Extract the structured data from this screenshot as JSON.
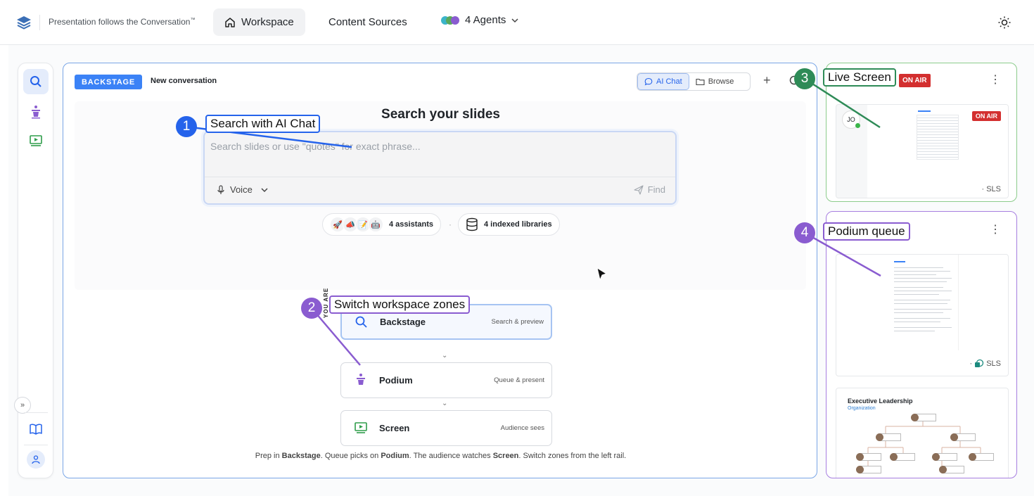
{
  "header": {
    "tagline": "Presentation follows the Conversation",
    "tagline_tm": "™",
    "nav": {
      "workspace": "Workspace",
      "content_sources": "Content Sources",
      "agents": "4 Agents"
    }
  },
  "colors": {
    "accent": "#3b82f6",
    "live": "#4caf50",
    "podium": "#8a5cd0",
    "onair": "#d32f2f"
  },
  "backstage": {
    "badge": "BACKSTAGE",
    "conversation": "New conversation",
    "tabs": {
      "chat": "AI Chat",
      "browse": "Browse"
    },
    "heading": "Search your slides",
    "search_placeholder": "Search slides or use \"quotes\" for exact phrase...",
    "voice": "Voice",
    "find": "Find",
    "assistants": "4 assistants",
    "libraries": "4 indexed libraries"
  },
  "zones": {
    "you_are_here": "YOU ARE",
    "items": [
      {
        "name": "Backstage",
        "desc": "Search & preview"
      },
      {
        "name": "Podium",
        "desc": "Queue & present"
      },
      {
        "name": "Screen",
        "desc": "Audience sees"
      }
    ],
    "footer": {
      "p1": "Prep in ",
      "b1": "Backstage",
      "p2": ". Queue picks on ",
      "b2": "Podium",
      "p3": ". The audience watches ",
      "b3": "Screen",
      "p4": ". Switch zones from the left rail."
    }
  },
  "live": {
    "onair": "ON AIR",
    "avatar": "JO",
    "source": "· SLS"
  },
  "podium": {
    "source": "SLS",
    "slide2_title": "Executive Leadership",
    "slide2_subtitle": "Organization"
  },
  "callouts": [
    {
      "num": "1",
      "label": "Search with AI Chat"
    },
    {
      "num": "2",
      "label": "Switch workspace zones"
    },
    {
      "num": "3",
      "label": "Live Screen"
    },
    {
      "num": "4",
      "label": "Podium queue"
    }
  ]
}
